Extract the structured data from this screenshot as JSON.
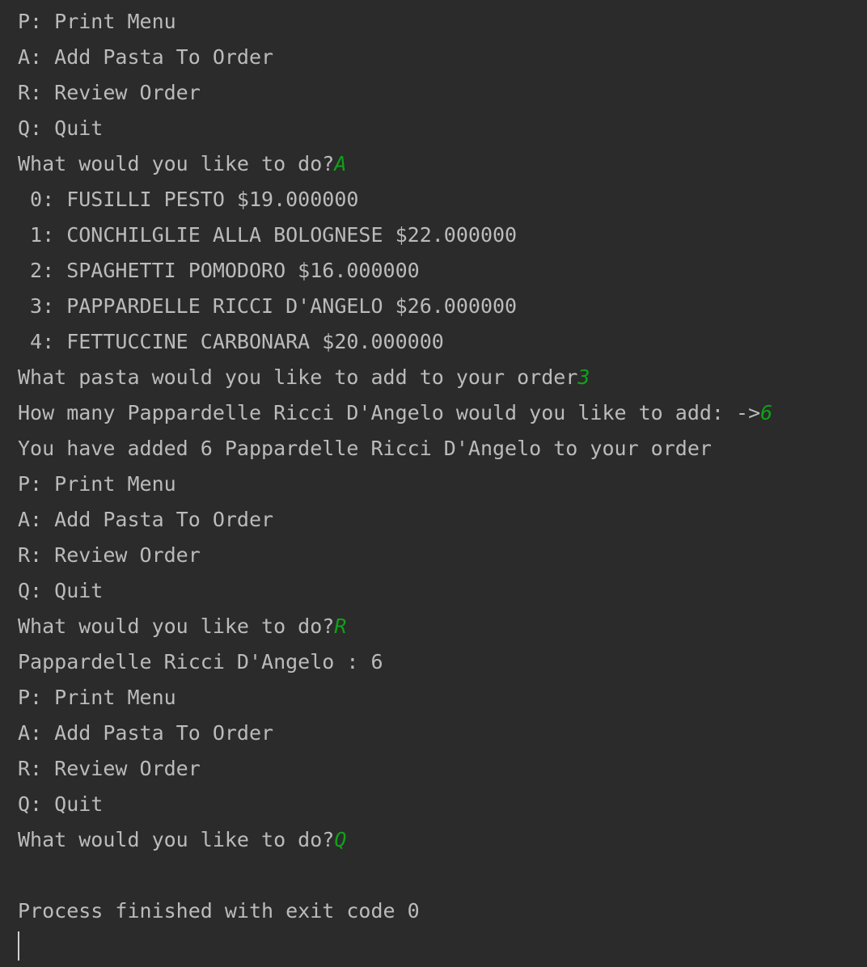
{
  "console": {
    "lines": [
      {
        "text": "P: Print Menu"
      },
      {
        "text": "A: Add Pasta To Order"
      },
      {
        "text": "R: Review Order"
      },
      {
        "text": "Q: Quit"
      },
      {
        "text": "What would you like to do?",
        "input": "A"
      },
      {
        "text": " 0: FUSILLI PESTO $19.000000"
      },
      {
        "text": " 1: CONCHILGLIE ALLA BOLOGNESE $22.000000"
      },
      {
        "text": " 2: SPAGHETTI POMODORO $16.000000"
      },
      {
        "text": " 3: PAPPARDELLE RICCI D'ANGELO $26.000000"
      },
      {
        "text": " 4: FETTUCCINE CARBONARA $20.000000"
      },
      {
        "text": "What pasta would you like to add to your order",
        "input": "3"
      },
      {
        "text": "How many Pappardelle Ricci D'Angelo would you like to add: ->",
        "input": "6"
      },
      {
        "text": "You have added 6 Pappardelle Ricci D'Angelo to your order"
      },
      {
        "text": "P: Print Menu"
      },
      {
        "text": "A: Add Pasta To Order"
      },
      {
        "text": "R: Review Order"
      },
      {
        "text": "Q: Quit"
      },
      {
        "text": "What would you like to do?",
        "input": "R"
      },
      {
        "text": "Pappardelle Ricci D'Angelo : 6"
      },
      {
        "text": "P: Print Menu"
      },
      {
        "text": "A: Add Pasta To Order"
      },
      {
        "text": "R: Review Order"
      },
      {
        "text": "Q: Quit"
      },
      {
        "text": "What would you like to do?",
        "input": "Q"
      },
      {
        "text": ""
      },
      {
        "text": "Process finished with exit code 0"
      }
    ]
  },
  "colors": {
    "background": "#2b2b2b",
    "output_text": "#bbbbbb",
    "user_input": "#11a01a"
  }
}
